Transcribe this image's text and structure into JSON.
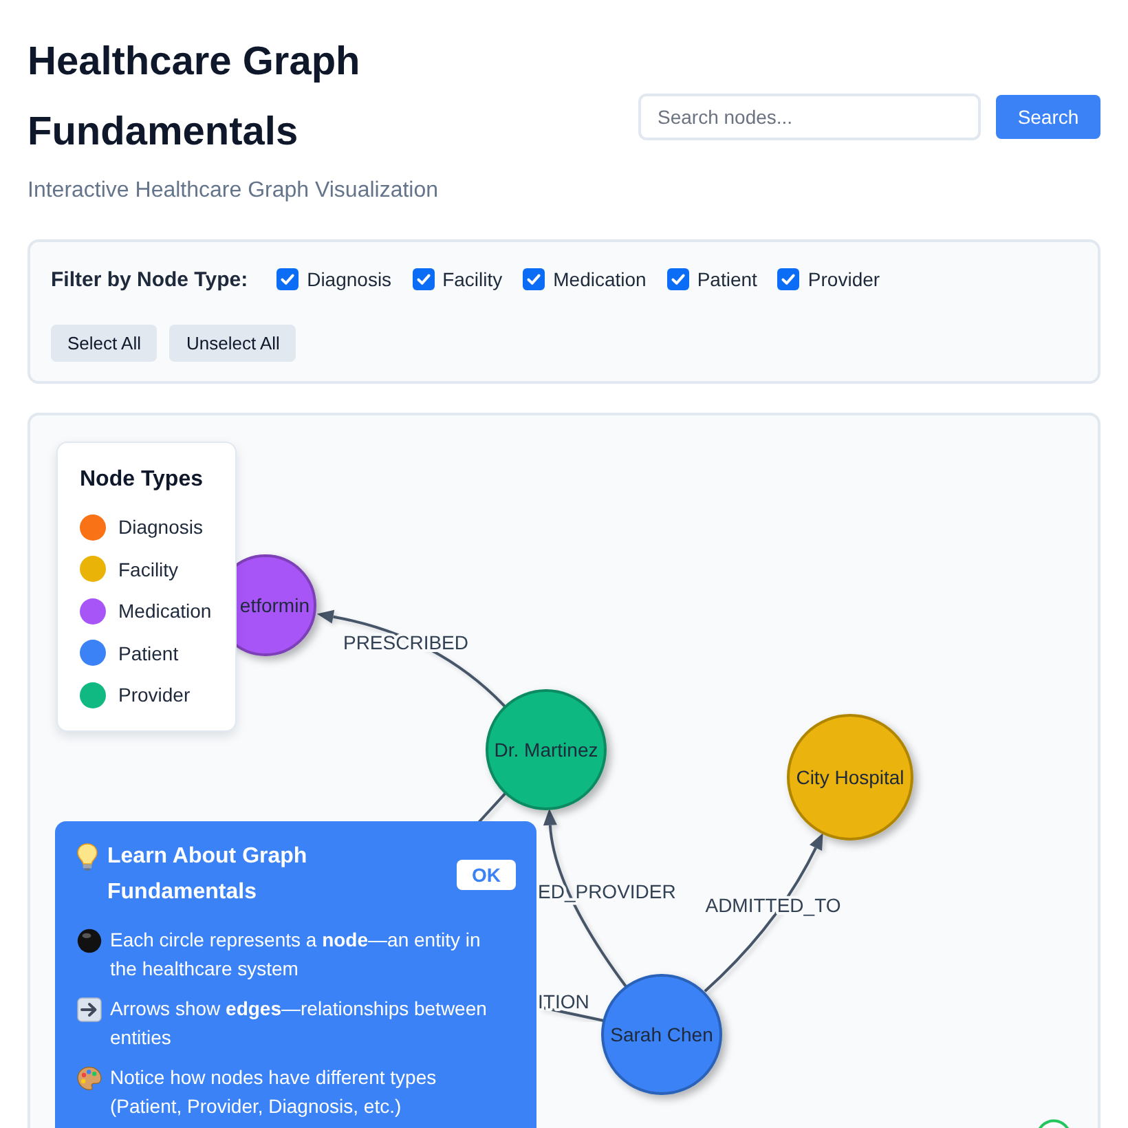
{
  "header": {
    "title": "Healthcare Graph Fundamentals",
    "subtitle": "Interactive Healthcare Graph Visualization"
  },
  "search": {
    "placeholder": "Search nodes...",
    "button": "Search"
  },
  "filter": {
    "label": "Filter by Node Type:",
    "options": [
      {
        "label": "Diagnosis",
        "checked": true
      },
      {
        "label": "Facility",
        "checked": true
      },
      {
        "label": "Medication",
        "checked": true
      },
      {
        "label": "Patient",
        "checked": true
      },
      {
        "label": "Provider",
        "checked": true
      }
    ],
    "buttons": [
      "Select All",
      "Unselect All"
    ]
  },
  "graph": {
    "legend": {
      "title": "Node Types",
      "items": [
        {
          "label": "Diagnosis",
          "color": "#f97316"
        },
        {
          "label": "Facility",
          "color": "#eab308"
        },
        {
          "label": "Medication",
          "color": "#a855f7"
        },
        {
          "label": "Patient",
          "color": "#3b82f6"
        },
        {
          "label": "Provider",
          "color": "#10b981"
        }
      ]
    },
    "nodes": [
      {
        "label": "etformin",
        "color": "#a855f7"
      },
      {
        "label": "Dr. Martinez",
        "color": "#10b981"
      },
      {
        "label": "City Hospital",
        "color": "#eab308"
      },
      {
        "label": "Sarah Chen",
        "color": "#3b82f6"
      }
    ],
    "edges": [
      {
        "label": "PRESCRIBED"
      },
      {
        "label": "ED_PROVIDER"
      },
      {
        "label": "ADMITTED_TO"
      },
      {
        "label": "ITION"
      }
    ]
  },
  "tip": {
    "title": "Learn About Graph Fundamentals",
    "button": "OK",
    "points": [
      "Each circle represents a **node**—an entity in the healthcare system",
      "Arrows show **edges**—relationships between entities",
      "Notice how nodes have different types (Patient, Provider, Diagnosis, etc.)"
    ]
  }
}
